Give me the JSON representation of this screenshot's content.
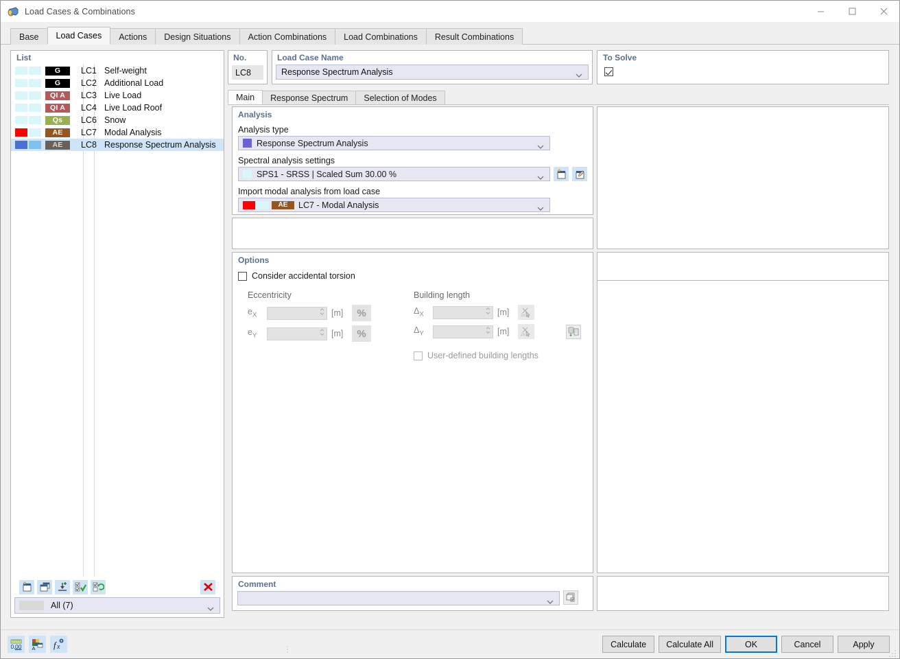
{
  "window": {
    "title": "Load Cases & Combinations",
    "icon": "load-case-icon",
    "controls": {
      "minimize": "–",
      "maximize": "□",
      "close": "✕"
    }
  },
  "tabs": [
    {
      "label": "Base",
      "active": false
    },
    {
      "label": "Load Cases",
      "active": true
    },
    {
      "label": "Actions",
      "active": false
    },
    {
      "label": "Design Situations",
      "active": false
    },
    {
      "label": "Action Combinations",
      "active": false
    },
    {
      "label": "Load Combinations",
      "active": false
    },
    {
      "label": "Result Combinations",
      "active": false
    }
  ],
  "list": {
    "header": "List",
    "rows": [
      {
        "no": "LC1",
        "name": "Self-weight",
        "badge": "G",
        "badge_bg": "#000000",
        "badge_fg": "#ffffff",
        "sw1": "#d9f6fb",
        "sw2": "#d9f6fb",
        "selected": false
      },
      {
        "no": "LC2",
        "name": "Additional Load",
        "badge": "G",
        "badge_bg": "#000000",
        "badge_fg": "#ffffff",
        "sw1": "#d9f6fb",
        "sw2": "#d9f6fb",
        "selected": false
      },
      {
        "no": "LC3",
        "name": "Live Load",
        "badge": "QI A",
        "badge_bg": "#b55a5a",
        "badge_fg": "#ffffff",
        "sw1": "#d9f6fb",
        "sw2": "#d9f6fb",
        "selected": false
      },
      {
        "no": "LC4",
        "name": "Live Load Roof",
        "badge": "QI A",
        "badge_bg": "#b55a5a",
        "badge_fg": "#ffffff",
        "sw1": "#d9f6fb",
        "sw2": "#d9f6fb",
        "selected": false
      },
      {
        "no": "LC6",
        "name": "Snow",
        "badge": "Qs",
        "badge_bg": "#9aaf52",
        "badge_fg": "#ffffff",
        "sw1": "#d9f6fb",
        "sw2": "#d9f6fb",
        "selected": false
      },
      {
        "no": "LC7",
        "name": "Modal Analysis",
        "badge": "AE",
        "badge_bg": "#97551f",
        "badge_fg": "#ffffff",
        "sw1": "#ff0000",
        "sw2": "#d9f6fb",
        "selected": false
      },
      {
        "no": "LC8",
        "name": "Response Spectrum Analysis",
        "badge": "AE",
        "badge_bg": "#6b6059",
        "badge_fg": "#d8d8d8",
        "sw1": "#4a6fd4",
        "sw2": "#7ec3ef",
        "selected": true
      }
    ],
    "toolbar": [
      {
        "name": "new-load-case-button",
        "icon": "new-window-icon"
      },
      {
        "name": "copy-load-case-button",
        "icon": "copy-window-icon"
      },
      {
        "name": "import-load-case-button",
        "icon": "import-icon"
      },
      {
        "name": "select-all-button",
        "icon": "check-all-icon"
      },
      {
        "name": "invert-selection-button",
        "icon": "swap-check-icon"
      },
      {
        "name": "delete-load-case-button",
        "icon": "delete-x-icon"
      }
    ],
    "filter": {
      "value": "All (7)"
    }
  },
  "header_fields": {
    "no_label": "No.",
    "no_value": "LC8",
    "name_label": "Load Case Name",
    "name_value": "Response Spectrum Analysis",
    "solve_label": "To Solve",
    "solve_checked": true
  },
  "inner_tabs": [
    {
      "label": "Main",
      "active": true
    },
    {
      "label": "Response Spectrum",
      "active": false
    },
    {
      "label": "Selection of Modes",
      "active": false
    }
  ],
  "analysis": {
    "group_title": "Analysis",
    "type_label": "Analysis type",
    "type_value": "Response Spectrum Analysis",
    "type_swatch": "#6a63d8",
    "settings_label": "Spectral analysis settings",
    "settings_value": "SPS1 - SRSS | Scaled Sum 30.00 %",
    "settings_swatch": "#d9f6fb",
    "new_settings_icon": "new-item-icon",
    "edit_settings_icon": "edit-item-icon",
    "import_label": "Import modal analysis from load case",
    "import_value": "LC7 - Modal Analysis",
    "import_sw1": "#ff0000",
    "import_sw2": "#d9f6fb",
    "import_badge": "AE",
    "import_badge_bg": "#97551f"
  },
  "options": {
    "group_title": "Options",
    "torsion_label": "Consider accidental torsion",
    "torsion_checked": false,
    "eccentricity_title": "Eccentricity",
    "building_length_title": "Building length",
    "rows": [
      {
        "ecc_key": "e",
        "ecc_sub": "X",
        "ecc_value": "",
        "ecc_unit": "[m]",
        "pct": "%",
        "len_key": "Δ",
        "len_sub": "X",
        "len_value": "",
        "len_unit": "[m]",
        "pick_icon": "pick-coordinate-icon"
      },
      {
        "ecc_key": "e",
        "ecc_sub": "Y",
        "ecc_value": "",
        "ecc_unit": "[m]",
        "pct": "%",
        "len_key": "Δ",
        "len_sub": "Y",
        "len_value": "",
        "len_unit": "[m]",
        "pick_icon": "pick-coordinate-icon"
      }
    ],
    "table_icon": "table-import-icon",
    "user_defined_label": "User-defined building lengths",
    "user_defined_checked": false
  },
  "comment": {
    "label": "Comment",
    "value": "",
    "icon": "comment-library-icon"
  },
  "statusbar": {
    "left_icons": [
      {
        "name": "decimal-places-icon",
        "label": "0,00"
      },
      {
        "name": "display-colors-icon",
        "label": ""
      },
      {
        "name": "formula-icon",
        "label": ""
      }
    ],
    "buttons": [
      {
        "label": "Calculate",
        "name": "calculate-button",
        "default": false
      },
      {
        "label": "Calculate All",
        "name": "calculate-all-button",
        "default": false
      },
      {
        "label": "OK",
        "name": "ok-button",
        "default": true
      },
      {
        "label": "Cancel",
        "name": "cancel-button",
        "default": false
      },
      {
        "label": "Apply",
        "name": "apply-button",
        "default": false
      }
    ]
  }
}
